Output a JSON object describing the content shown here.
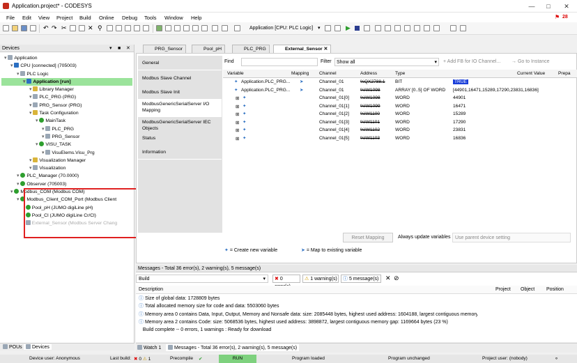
{
  "window": {
    "title": "Application.project* - CODESYS",
    "badge": "28"
  },
  "menu": [
    "File",
    "Edit",
    "View",
    "Project",
    "Build",
    "Online",
    "Debug",
    "Tools",
    "Window",
    "Help"
  ],
  "toolbar": {
    "app_label": "Application [CPU: PLC Logic]"
  },
  "devices": {
    "title": "Devices",
    "tree": [
      {
        "label": "Application",
        "level": 0,
        "icon": "ico-gray"
      },
      {
        "label": "CPU [connected] (705003)",
        "level": 1,
        "icon": "ico-blue"
      },
      {
        "label": "PLC Logic",
        "level": 2,
        "icon": "ico-gray"
      },
      {
        "label": "Application [run]",
        "level": 3,
        "icon": "ico-blue"
      },
      {
        "label": "Library Manager",
        "level": 4,
        "icon": "ico-yellow"
      },
      {
        "label": "PLC_PRG (PRG)",
        "level": 4,
        "icon": "ico-gray"
      },
      {
        "label": "PRG_Sensor (PRG)",
        "level": 4,
        "icon": "ico-gray"
      },
      {
        "label": "Task Configuration",
        "level": 4,
        "icon": "ico-yellow"
      },
      {
        "label": "MainTask",
        "level": 5,
        "icon": "ico-green"
      },
      {
        "label": "PLC_PRG",
        "level": 6,
        "icon": "ico-gray"
      },
      {
        "label": "PRG_Sensor",
        "level": 6,
        "icon": "ico-gray"
      },
      {
        "label": "VISU_TASK",
        "level": 5,
        "icon": "ico-green"
      },
      {
        "label": "VisuElems.Visu_Prg",
        "level": 6,
        "icon": "ico-gray"
      },
      {
        "label": "Visualization Manager",
        "level": 4,
        "icon": "ico-yellow"
      },
      {
        "label": "Visualization",
        "level": 4,
        "icon": "ico-gray"
      },
      {
        "label": "PLC_Manager (70.0000)",
        "level": 2,
        "icon": "ico-green"
      },
      {
        "label": "Observer (705003)",
        "level": 2,
        "icon": "ico-green"
      },
      {
        "label": "Modbus_COM (Modbus COM)",
        "level": 1,
        "icon": "ico-green"
      },
      {
        "label": "Modbus_Client_COM_Port (Modbus Client",
        "level": 2,
        "icon": "ico-green"
      },
      {
        "label": "Pool_pH (JUMO digiLine pH)",
        "level": 3,
        "icon": "ico-green"
      },
      {
        "label": "Pool_Cl (JUMO digiLine Cr/Cl)",
        "level": 3,
        "icon": "ico-green"
      },
      {
        "label": "External_Sensor (Modbus Server Chang",
        "level": 3,
        "icon": "ico-gray",
        "dim": true
      }
    ],
    "bottom_tabs": [
      "POUs",
      "Devices"
    ]
  },
  "editor_tabs": [
    "PRG_Sensor",
    "Pool_pH",
    "PLC_PRG",
    "External_Sensor"
  ],
  "side_tabs": [
    "General",
    "Modbus Slave Channel",
    "Modbus Slave Init",
    "ModbusGenericSerialServer I/O Mapping",
    "ModbusGenericSerialServer IEC Objects",
    "Status",
    "Information"
  ],
  "find": {
    "find_label": "Find",
    "filter_label": "Filter",
    "filter_value": "Show all",
    "add_fb": "Add FB for IO Channel...",
    "goto": "Go to Instance"
  },
  "grid": {
    "headers": [
      "Variable",
      "Mapping",
      "Channel",
      "Address",
      "Type",
      "Current Value",
      "Prepa"
    ],
    "rows": [
      {
        "var": "Application.PLC_PRG...",
        "channel": "Channel_01",
        "address": "%QX2788.1",
        "type": "BIT",
        "value": "TRUE",
        "highlight": true
      },
      {
        "var": "Application.PLC_PRG...",
        "channel": "Channel_01",
        "address": "%IW1098",
        "type": "ARRAY [0..5] OF WORD",
        "value": "[44901,16471,15289,17290,23831,16836]"
      },
      {
        "var": "",
        "channel": "Channel_01[0]",
        "address": "%IW1098",
        "type": "WORD",
        "value": "44901"
      },
      {
        "var": "",
        "channel": "Channel_01[1]",
        "address": "%IW1099",
        "type": "WORD",
        "value": "16471"
      },
      {
        "var": "",
        "channel": "Channel_01[2]",
        "address": "%IW1100",
        "type": "WORD",
        "value": "15289"
      },
      {
        "var": "",
        "channel": "Channel_01[3]",
        "address": "%IW1101",
        "type": "WORD",
        "value": "17290"
      },
      {
        "var": "",
        "channel": "Channel_01[4]",
        "address": "%IW1102",
        "type": "WORD",
        "value": "23831"
      },
      {
        "var": "",
        "channel": "Channel_01[5]",
        "address": "%IW1103",
        "type": "WORD",
        "value": "16836"
      }
    ]
  },
  "mapping_footer": {
    "reset": "Reset Mapping",
    "always_update": "Always update variables",
    "update_value": "Use parent device setting",
    "create_var": "= Create new variable",
    "map_existing": "= Map to existing variable"
  },
  "messages": {
    "title": "Messages - Total 36 error(s), 2 warning(s), 5 message(s)",
    "source": "Build",
    "errors": "0 error(s)",
    "warnings": "1 warning(s)",
    "msgs": "5 message(s)",
    "cols": [
      "Description",
      "Project",
      "Object",
      "Position"
    ],
    "rows": [
      "Size of global data: 1728809 bytes",
      "Total allocated memory size for code and data: 5503060 bytes",
      "Memory area 0 contains  Data, Input, Output, Memory and Nonsafe data: size: 2085448 bytes, highest used address: 1604188, largest contiguous memory gap: ...",
      "Memory area 2 contains  Code: size: 5068536 bytes, highest used address: 3898872, largest contiguous memory gap: 1169664 bytes (23 %)",
      "Build complete -- 0 errors, 1 warnings : Ready for download"
    ],
    "bottom_tabs": [
      "Watch 1",
      "Messages - Total 36 error(s), 2 warning(s), 5 message(s)"
    ]
  },
  "status": {
    "device_user": "Device user: Anonymous",
    "last_build": "Last build:",
    "lb_err": "0",
    "lb_warn": "1",
    "precompile": "Precompile",
    "run": "RUN",
    "program_loaded": "Program loaded",
    "program_unchanged": "Program unchanged",
    "project_user": "Project user: (nobody)"
  }
}
